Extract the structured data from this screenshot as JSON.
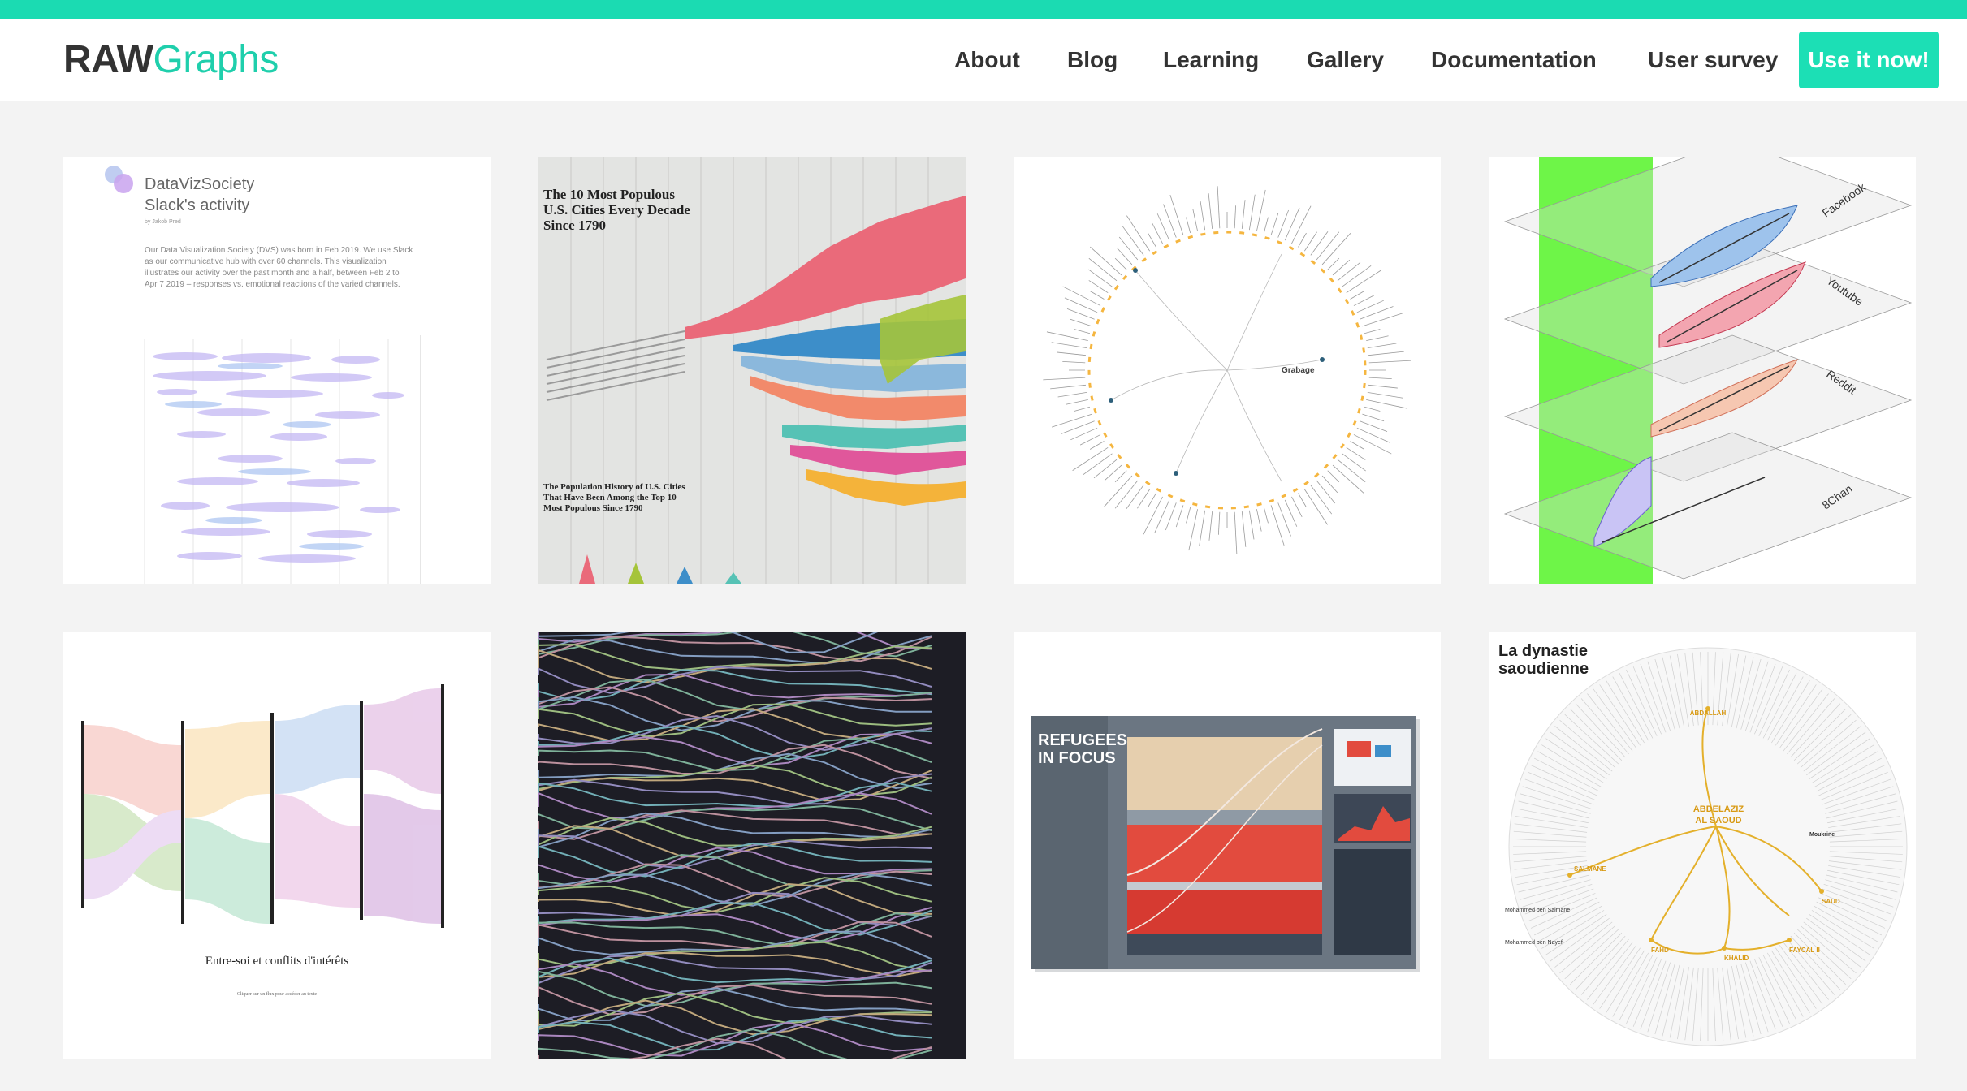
{
  "brand": {
    "logo_bold": "RAW",
    "logo_light": "Graphs",
    "accent": "#1bdbb2"
  },
  "nav": {
    "items": [
      {
        "label": "About"
      },
      {
        "label": "Blog"
      },
      {
        "label": "Learning"
      },
      {
        "label": "Gallery"
      },
      {
        "label": "Documentation"
      },
      {
        "label": "User survey"
      }
    ],
    "cta_label": "Use it now!"
  },
  "gallery": {
    "cards": [
      {
        "title": "DataVizSociety",
        "subtitle": "Slack's activity",
        "byline": "by Jakob Pred",
        "text_lines": [
          "Our Data Visualization Society (DVS) was born in Feb 2019. We use Slack",
          "as our communicative hub with over 60 channels. This visualization",
          "illustrates our activity over the past month and a half, between Feb 2 to",
          "Apr 7 2019 – responses vs. emotional reactions of the varied channels."
        ]
      },
      {
        "title_lines": [
          "The 10 Most Populous",
          "U.S. Cities Every Decade",
          "Since 1790"
        ],
        "subtitle_lines": [
          "The Population History of U.S. Cities",
          "That Have Been Among the Top 10",
          "Most Populous Since 1790"
        ]
      },
      {
        "center_label": "Grabage"
      },
      {
        "labels": [
          "Facebook",
          "Youtube",
          "Reddit",
          "8Chan"
        ]
      },
      {
        "caption": "Entre-soi et conflits d'intérêts",
        "subcaption": "Cliquer sur un flux pour accéder au texte"
      },
      {},
      {
        "title_lines": [
          "REFUGEES",
          "IN FOCUS"
        ]
      },
      {
        "title_lines": [
          "La dynastie",
          "saoudienne"
        ],
        "center_lines": [
          "ABDELAZIZ",
          "AL SAOUD"
        ],
        "names": [
          "ABDALLAH",
          "SALMANE",
          "Mohammed ben Salmane",
          "Mohammed ben Nayef",
          "KHALID",
          "FAHD",
          "FAYCAL II",
          "SAUD",
          "Moukrine"
        ]
      }
    ]
  }
}
